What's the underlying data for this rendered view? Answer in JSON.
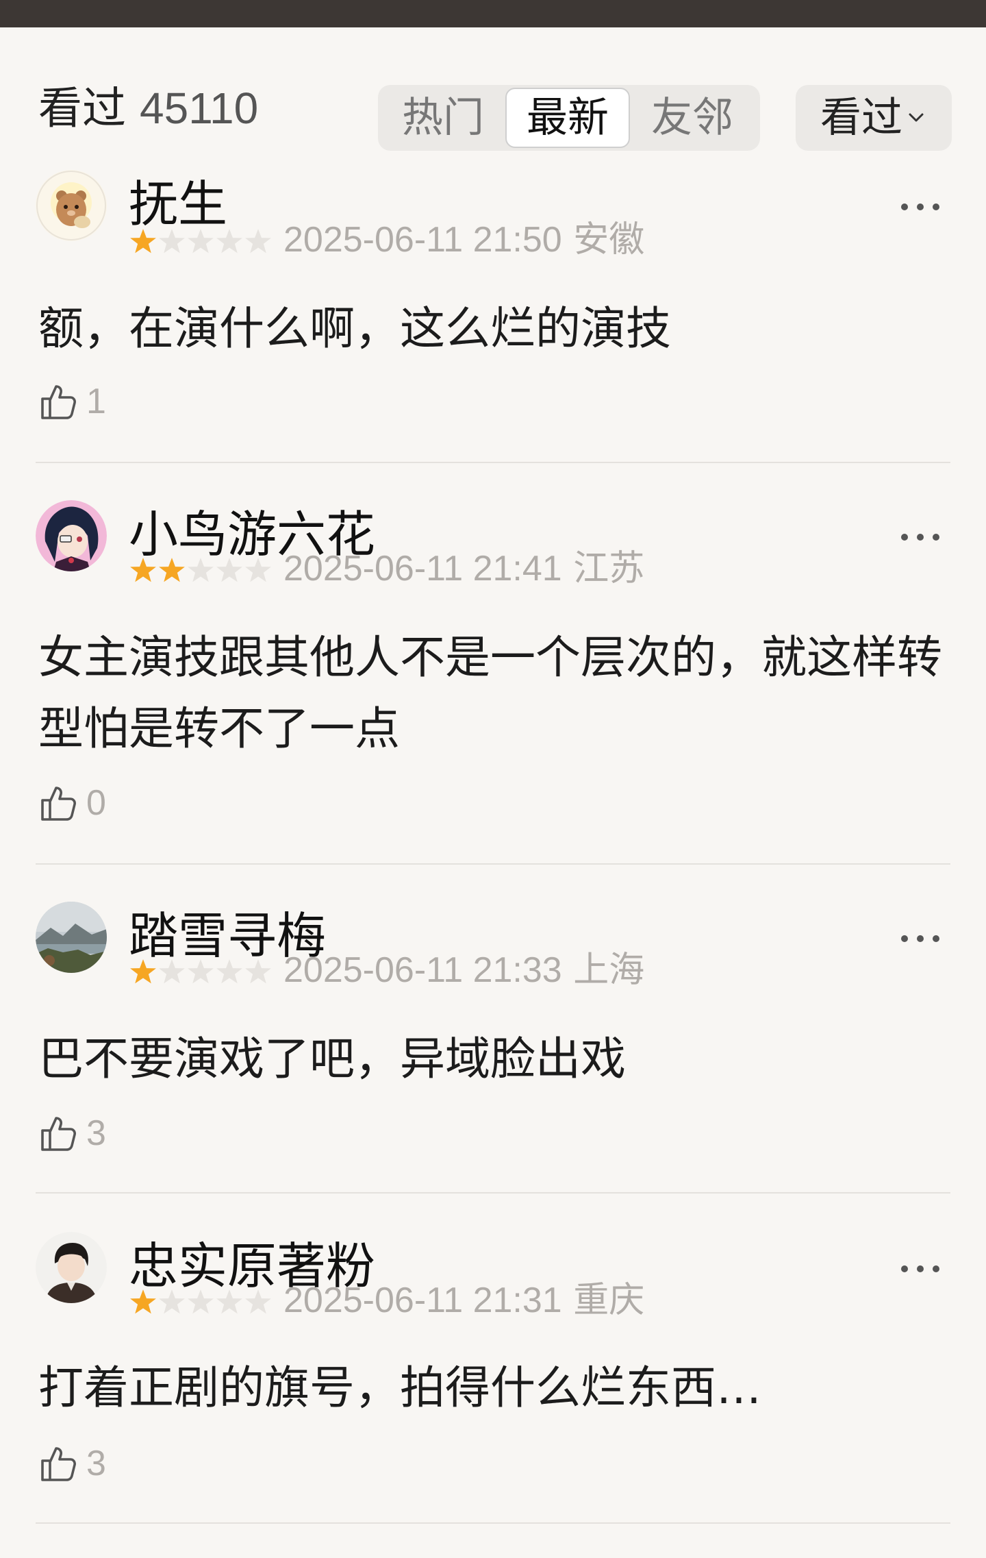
{
  "header": {
    "count_label": "看过",
    "count_value": "45110",
    "tabs": [
      {
        "label": "热门",
        "active": false
      },
      {
        "label": "最新",
        "active": true
      },
      {
        "label": "友邻",
        "active": false
      }
    ],
    "filter_label": "看过",
    "filter_icon": "chevron-down-icon"
  },
  "reviews": [
    {
      "username": "抚生",
      "rating": 1,
      "max_rating": 5,
      "date": "2025-06-11 21:50",
      "location": "安徽",
      "content": "额，在演什么啊，这么烂的演技",
      "likes": "1",
      "avatar_icon": "bear-avatar-icon"
    },
    {
      "username": "小鸟游六花",
      "rating": 2,
      "max_rating": 5,
      "date": "2025-06-11 21:41",
      "location": "江苏",
      "content": "女主演技跟其他人不是一个层次的，就这样转型怕是转不了一点",
      "likes": "0",
      "avatar_icon": "anime-girl-avatar-icon"
    },
    {
      "username": "踏雪寻梅",
      "rating": 1,
      "max_rating": 5,
      "date": "2025-06-11 21:33",
      "location": "上海",
      "content": "巴不要演戏了吧，异域脸出戏",
      "likes": "3",
      "avatar_icon": "landscape-avatar-icon"
    },
    {
      "username": "忠实原著粉",
      "rating": 1,
      "max_rating": 5,
      "date": "2025-06-11 21:31",
      "location": "重庆",
      "content": "打着正剧的旗号，拍得什么烂东西…",
      "likes": "3",
      "avatar_icon": "person-avatar-icon"
    }
  ],
  "colors": {
    "background": "#f8f6f3",
    "star_filled": "#f6a623",
    "star_empty": "#e6e3df",
    "meta_text": "#b0aca8",
    "top_bar": "#3d3734"
  }
}
